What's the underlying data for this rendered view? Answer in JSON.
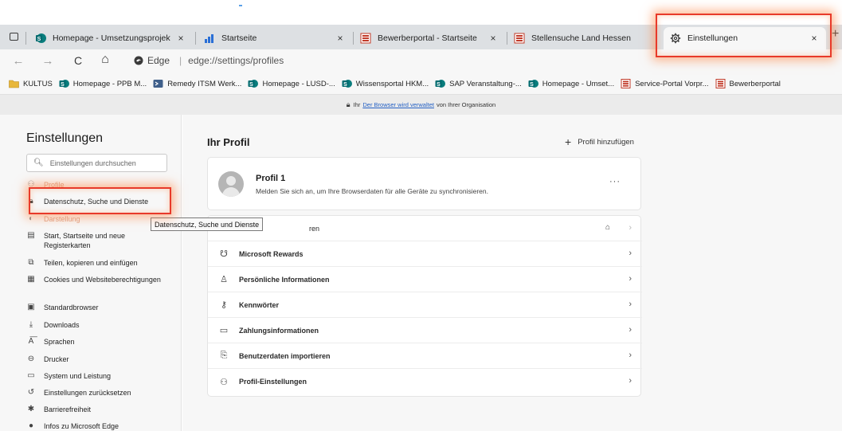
{
  "tabs": [
    {
      "title": "Homepage - Umsetzungsprojekt",
      "close": "×",
      "icon": "sharepoint-icon"
    },
    {
      "title": "Startseite",
      "close": "×",
      "icon": "chart-icon"
    },
    {
      "title": "Bewerberportal - Startseite",
      "close": "×",
      "icon": "hessen-icon"
    },
    {
      "title": "Stellensuche Land Hessen",
      "close": "×",
      "icon": "hessen-icon"
    },
    {
      "title": "Einstellungen",
      "close": "×",
      "icon": "gear-icon"
    }
  ],
  "new_tab": "+",
  "toolbar": {
    "back": "←",
    "forward": "→",
    "reload": "C",
    "home": "⌂",
    "browser": "Edge",
    "separator": "|",
    "url": "edge://settings/profiles"
  },
  "bookmarks": [
    {
      "label": "KULTUS",
      "icon": "folder-icon"
    },
    {
      "label": "Homepage - PPB M...",
      "icon": "sharepoint-icon"
    },
    {
      "label": "Remedy ITSM Werk...",
      "icon": "remedy-icon"
    },
    {
      "label": "Homepage - LUSD-...",
      "icon": "sharepoint-icon"
    },
    {
      "label": "Wissensportal HKM...",
      "icon": "sharepoint-icon"
    },
    {
      "label": "SAP Veranstaltung-...",
      "icon": "sharepoint-icon"
    },
    {
      "label": "Homepage - Umset...",
      "icon": "sharepoint-icon"
    },
    {
      "label": "Service-Portal Vorpr...",
      "icon": "hessen-icon"
    },
    {
      "label": "Bewerberportal",
      "icon": "hessen-icon"
    }
  ],
  "managed_banner": {
    "prefix": "Ihr",
    "link": "Der Browser wird verwaltet",
    "suffix": "von Ihrer Organisation"
  },
  "sidebar": {
    "title": "Einstellungen",
    "search_placeholder": "Einstellungen durchsuchen",
    "items": [
      {
        "label": "Profile",
        "icon": "profile-icon"
      },
      {
        "label": "Datenschutz, Suche und Dienste",
        "icon": "lock-icon"
      },
      {
        "label": "Darstellung",
        "icon": "appearance-icon"
      },
      {
        "label": "Start, Startseite und neue Registerkarten",
        "icon": "start-page-icon"
      },
      {
        "label": "Teilen, kopieren und einfügen",
        "icon": "share-icon"
      },
      {
        "label": "Cookies und Websiteberechtigungen",
        "icon": "cookie-icon"
      },
      {
        "label": "Standardbrowser",
        "icon": "browser-icon"
      },
      {
        "label": "Downloads",
        "icon": "download-icon"
      },
      {
        "label": "Sprachen",
        "icon": "language-icon"
      },
      {
        "label": "Drucker",
        "icon": "printer-icon"
      },
      {
        "label": "System und Leistung",
        "icon": "system-icon"
      },
      {
        "label": "Einstellungen zurücksetzen",
        "icon": "reset-icon"
      },
      {
        "label": "Barrierefreiheit",
        "icon": "accessibility-icon"
      },
      {
        "label": "Infos zu Microsoft Edge",
        "icon": "edge-icon"
      }
    ]
  },
  "tooltip": "Datenschutz, Suche und Dienste",
  "main": {
    "title": "Ihr Profil",
    "add_profile": "Profil hinzufügen",
    "profile": {
      "name": "Profil 1",
      "description": "Melden Sie sich an, um Ihre Browserdaten für alle Geräte zu synchronisieren.",
      "more": "···"
    },
    "rows": [
      {
        "label": "ren",
        "icon": "sync-icon"
      },
      {
        "label": "Microsoft Rewards",
        "icon": "rewards-icon"
      },
      {
        "label": "Persönliche Informationen",
        "icon": "person-icon"
      },
      {
        "label": "Kennwörter",
        "icon": "key-icon"
      },
      {
        "label": "Zahlungsinformationen",
        "icon": "card-icon"
      },
      {
        "label": "Benutzerdaten importieren",
        "icon": "import-icon"
      },
      {
        "label": "Profil-Einstellungen",
        "icon": "profile-settings-icon"
      }
    ]
  },
  "colors": {
    "highlight": "#e83a2a",
    "link": "#2561c4",
    "tabstrip": "#dde0e3",
    "page_bg": "#f7f7f7"
  }
}
